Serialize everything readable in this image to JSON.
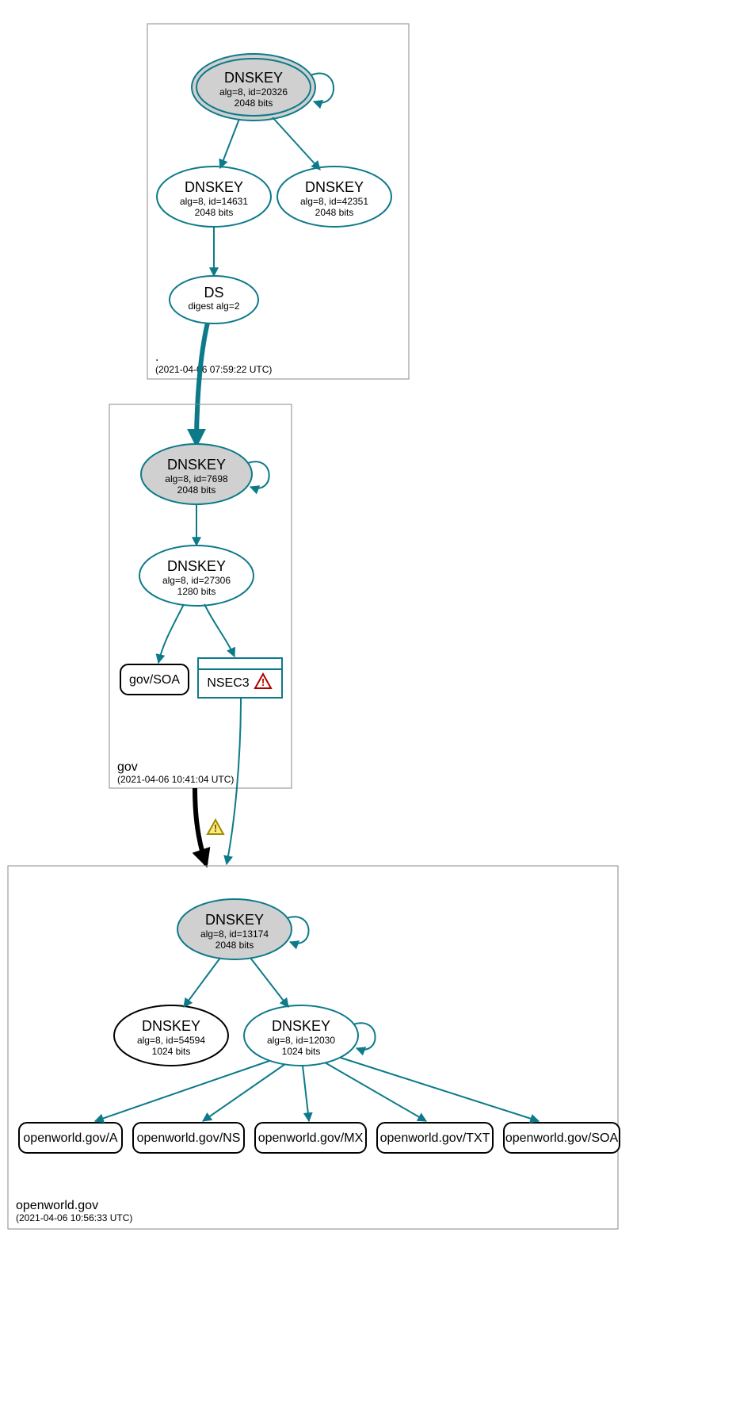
{
  "zones": {
    "root": {
      "name": ".",
      "timestamp": "(2021-04-06 07:59:22 UTC)",
      "ksk": {
        "title": "DNSKEY",
        "line1": "alg=8, id=20326",
        "line2": "2048 bits"
      },
      "zsk1": {
        "title": "DNSKEY",
        "line1": "alg=8, id=14631",
        "line2": "2048 bits"
      },
      "zsk2": {
        "title": "DNSKEY",
        "line1": "alg=8, id=42351",
        "line2": "2048 bits"
      },
      "ds": {
        "title": "DS",
        "line1": "digest alg=2"
      }
    },
    "gov": {
      "name": "gov",
      "timestamp": "(2021-04-06 10:41:04 UTC)",
      "ksk": {
        "title": "DNSKEY",
        "line1": "alg=8, id=7698",
        "line2": "2048 bits"
      },
      "zsk": {
        "title": "DNSKEY",
        "line1": "alg=8, id=27306",
        "line2": "1280 bits"
      },
      "soa": "gov/SOA",
      "nsec3": "NSEC3"
    },
    "openworld": {
      "name": "openworld.gov",
      "timestamp": "(2021-04-06 10:56:33 UTC)",
      "ksk": {
        "title": "DNSKEY",
        "line1": "alg=8, id=13174",
        "line2": "2048 bits"
      },
      "zsk1": {
        "title": "DNSKEY",
        "line1": "alg=8, id=54594",
        "line2": "1024 bits"
      },
      "zsk2": {
        "title": "DNSKEY",
        "line1": "alg=8, id=12030",
        "line2": "1024 bits"
      },
      "rr": {
        "a": "openworld.gov/A",
        "ns": "openworld.gov/NS",
        "mx": "openworld.gov/MX",
        "txt": "openworld.gov/TXT",
        "soa": "openworld.gov/SOA"
      }
    }
  },
  "icons": {
    "error": "error-triangle",
    "warning": "warning-triangle"
  },
  "colors": {
    "teal": "#0d7a8a",
    "grey": "#d0d0d0",
    "black": "#000000",
    "warnFill": "#ffe680",
    "warnStroke": "#998f00",
    "errFill": "#ffffff",
    "errStroke": "#b00000"
  }
}
